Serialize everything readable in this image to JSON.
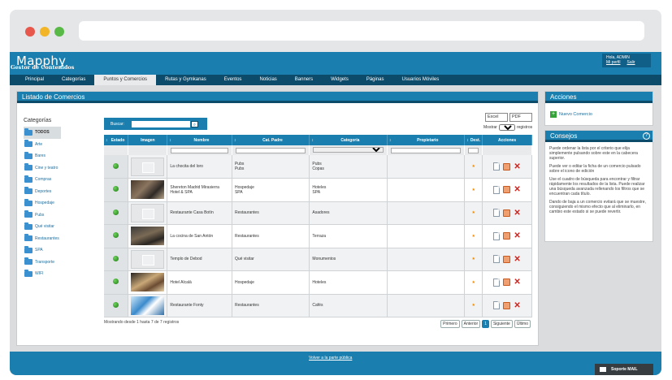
{
  "header": {
    "logo": "Mapphy",
    "subtitle": "Gestor de Contenidos",
    "greeting": "Hola, ADMIN",
    "profile_link": "Mi perfil",
    "logout_link": "Salir"
  },
  "nav": [
    "Principal",
    "Categorías",
    "Puntos y Comercios",
    "Rutas y Gymkanas",
    "Eventos",
    "Noticias",
    "Banners",
    "Widgets",
    "Páginas",
    "Usuarios Móviles"
  ],
  "listado": {
    "title": "Listado de Comercios",
    "categories_title": "Categorías",
    "categories": [
      "TODOS",
      "Arte",
      "Bares",
      "Cine y teatro",
      "Compras",
      "Deportes",
      "Hospedaje",
      "Pubs",
      "Qué visitar",
      "Restaurantes",
      "SPA",
      "Transporte",
      "WIFI"
    ],
    "search_label": "Buscar:",
    "search_icon": "search-icon",
    "export_excel": "Excel",
    "export_pdf": "PDF",
    "show_label": "Mostrar",
    "show_value": "50",
    "show_suffix": "registros",
    "columns": [
      "Estado",
      "Imagen",
      "Nombre",
      "Cat. Padre",
      "Categoría",
      "Propietario",
      "Dest.",
      "Acciones"
    ],
    "rows": [
      {
        "nombre": "La chocita del loro",
        "cat_padre": "Pubs\nPubs",
        "categoria": "Pubs\nCopas",
        "propietario": ""
      },
      {
        "nombre": "Shereton Madrid Mirasierra\nHotel & SPA",
        "cat_padre": "Hospedaje\nSPA",
        "categoria": "Hoteles\nSPA",
        "propietario": ""
      },
      {
        "nombre": "Restaurante Casa Botín",
        "cat_padre": "Restaurantes",
        "categoria": "Asadores",
        "propietario": ""
      },
      {
        "nombre": "La cocina de San Antón",
        "cat_padre": "Restaurantes",
        "categoria": "Terraza",
        "propietario": ""
      },
      {
        "nombre": "Templo de Debod",
        "cat_padre": "Qué visitar",
        "categoria": "Monumentos",
        "propietario": ""
      },
      {
        "nombre": "Hotel Alcalá",
        "cat_padre": "Hospedaje",
        "categoria": "Hoteles",
        "propietario": ""
      },
      {
        "nombre": "Restaurante Fonty",
        "cat_padre": "Restaurantes",
        "categoria": "Cafés",
        "propietario": ""
      }
    ],
    "info": "Mostrando desde 1 hasta 7 de 7 registros",
    "pager": {
      "first": "Primero",
      "prev": "Anterior",
      "current": "1",
      "next": "Siguiente",
      "last": "Último"
    }
  },
  "acciones": {
    "title": "Acciones",
    "nuevo": "Nuevo Comercio"
  },
  "consejos": {
    "title": "Consejos",
    "tips": [
      "Puede ordenar la lista por el criterio que elija simplemente pulsando sobre este en la cabecera superior.",
      "Puede ver o editar la ficha de un comercio pulsado sobre el icono de edición",
      "Use el cuadro de búsqueda para encontrar y filtrar rápidamente los resultados de la lista. Puede realizar una búsqueda avanzada rellenando los filtros que se encuentran cada título.",
      "Dando de baja a un comercio evitará que se muestre, consiguiendo el mismo efecto que al eliminarlo, en cambio este estado si se puede revertir."
    ]
  },
  "footer": {
    "link": "Volver a la parte pública",
    "support": "Soporte MAIL"
  },
  "colors": {
    "primary": "#1a7fae",
    "dark": "#0d4b6a",
    "star": "#f08a00",
    "delete": "#d2201a"
  }
}
